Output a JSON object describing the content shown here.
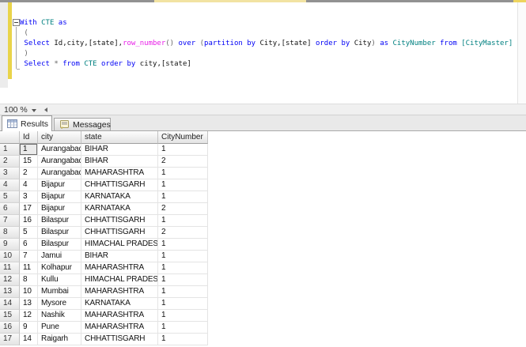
{
  "colors": {
    "keyword": "#0000f5",
    "identifier": "#008080",
    "system_function": "#e81ee8",
    "operator": "#666666",
    "plain_text": "#131313",
    "change_track_bar": "#e9d44a",
    "tab_strip_bg": "#e9e9e9",
    "grid_header_border": "#9f9f9f"
  },
  "editor": {
    "zoom_control": {
      "label": "100 %"
    },
    "lines": [
      {
        "tokens": [
          {
            "t": "With",
            "c": "kw"
          },
          {
            "t": " ",
            "c": "plain"
          },
          {
            "t": "CTE",
            "c": "id"
          },
          {
            "t": " ",
            "c": "plain"
          },
          {
            "t": "as",
            "c": "kw"
          }
        ]
      },
      {
        "tokens": [
          {
            "t": " (",
            "c": "op"
          }
        ]
      },
      {
        "tokens": [
          {
            "t": " ",
            "c": "plain"
          },
          {
            "t": "Select",
            "c": "kw"
          },
          {
            "t": " Id,city,[state],",
            "c": "plain"
          },
          {
            "t": "row_number",
            "c": "fn"
          },
          {
            "t": "()",
            "c": "op"
          },
          {
            "t": " ",
            "c": "plain"
          },
          {
            "t": "over",
            "c": "kw"
          },
          {
            "t": " ",
            "c": "plain"
          },
          {
            "t": "(",
            "c": "op"
          },
          {
            "t": "partition by",
            "c": "kw"
          },
          {
            "t": " City,[state] ",
            "c": "plain"
          },
          {
            "t": "order by",
            "c": "kw"
          },
          {
            "t": " City",
            "c": "plain"
          },
          {
            "t": ")",
            "c": "op"
          },
          {
            "t": " ",
            "c": "plain"
          },
          {
            "t": "as",
            "c": "kw"
          },
          {
            "t": " ",
            "c": "plain"
          },
          {
            "t": "CityNumber",
            "c": "id"
          },
          {
            "t": " ",
            "c": "plain"
          },
          {
            "t": "from",
            "c": "kw"
          },
          {
            "t": " ",
            "c": "plain"
          },
          {
            "t": "[CityMaster]",
            "c": "id"
          }
        ]
      },
      {
        "tokens": [
          {
            "t": " )",
            "c": "op"
          }
        ]
      },
      {
        "tokens": [
          {
            "t": " ",
            "c": "plain"
          },
          {
            "t": "Select",
            "c": "kw"
          },
          {
            "t": " ",
            "c": "plain"
          },
          {
            "t": "*",
            "c": "op"
          },
          {
            "t": " ",
            "c": "plain"
          },
          {
            "t": "from",
            "c": "kw"
          },
          {
            "t": " ",
            "c": "plain"
          },
          {
            "t": "CTE",
            "c": "id"
          },
          {
            "t": " ",
            "c": "plain"
          },
          {
            "t": "order by",
            "c": "kw"
          },
          {
            "t": " city,[state]",
            "c": "plain"
          }
        ]
      }
    ]
  },
  "result_tabs": [
    {
      "label": "Results",
      "icon": "results-grid-icon",
      "active": true
    },
    {
      "label": "Messages",
      "icon": "messages-icon",
      "active": false
    }
  ],
  "grid": {
    "columns": [
      "",
      "Id",
      "city",
      "state",
      "CityNumber"
    ],
    "selection": {
      "row_n": "1",
      "column": "Id"
    },
    "rows": [
      {
        "n": "1",
        "cells": [
          "1",
          "Aurangabad",
          "BIHAR",
          "1"
        ]
      },
      {
        "n": "2",
        "cells": [
          "15",
          "Aurangabad",
          "BIHAR",
          "2"
        ]
      },
      {
        "n": "3",
        "cells": [
          "2",
          "Aurangabad",
          "MAHARASHTRA",
          "1"
        ]
      },
      {
        "n": "4",
        "cells": [
          "4",
          "Bijapur",
          "CHHATTISGARH",
          "1"
        ]
      },
      {
        "n": "5",
        "cells": [
          "3",
          "Bijapur",
          "KARNATAKA",
          "1"
        ]
      },
      {
        "n": "6",
        "cells": [
          "17",
          "Bijapur",
          "KARNATAKA",
          "2"
        ]
      },
      {
        "n": "7",
        "cells": [
          "16",
          "Bilaspur",
          "CHHATTISGARH",
          "1"
        ]
      },
      {
        "n": "8",
        "cells": [
          "5",
          "Bilaspur",
          "CHHATTISGARH",
          "2"
        ]
      },
      {
        "n": "9",
        "cells": [
          "6",
          "Bilaspur",
          "HIMACHAL PRADESH",
          "1"
        ]
      },
      {
        "n": "10",
        "cells": [
          "7",
          "Jamui",
          "BIHAR",
          "1"
        ]
      },
      {
        "n": "11",
        "cells": [
          "11",
          "Kolhapur",
          "MAHARASHTRA",
          "1"
        ]
      },
      {
        "n": "12",
        "cells": [
          "8",
          "Kullu",
          "HIMACHAL PRADESH",
          "1"
        ]
      },
      {
        "n": "13",
        "cells": [
          "10",
          "Mumbai",
          "MAHARASHTRA",
          "1"
        ]
      },
      {
        "n": "14",
        "cells": [
          "13",
          "Mysore",
          "KARNATAKA",
          "1"
        ]
      },
      {
        "n": "15",
        "cells": [
          "12",
          "Nashik",
          "MAHARASHTRA",
          "1"
        ]
      },
      {
        "n": "16",
        "cells": [
          "9",
          "Pune",
          "MAHARASHTRA",
          "1"
        ]
      },
      {
        "n": "17",
        "cells": [
          "14",
          "Raigarh",
          "CHHATTISGARH",
          "1"
        ]
      }
    ]
  }
}
